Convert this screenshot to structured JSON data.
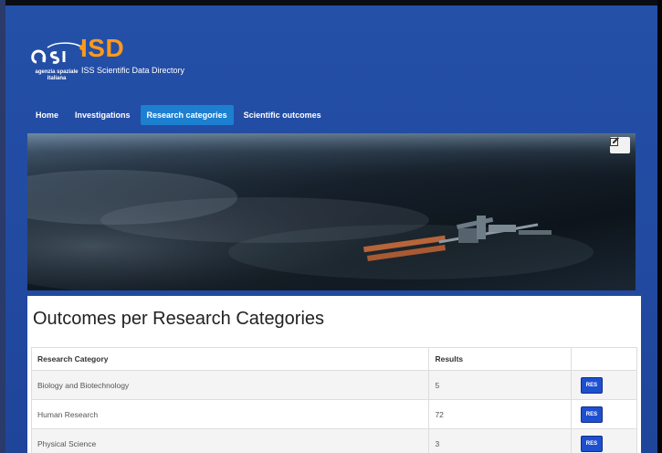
{
  "header": {
    "logo_caption": "agenzia spaziale italiana",
    "title": "ISD",
    "subtitle": "ISS Scientific Data Directory",
    "title_color": "#ff9a1a"
  },
  "nav": {
    "items": [
      {
        "label": "Home"
      },
      {
        "label": "Investigations"
      },
      {
        "label": "Research categories",
        "active": true
      },
      {
        "label": "Scientific outcomes"
      }
    ],
    "active_color": "#1d7fd0"
  },
  "hero": {
    "image": "earth-and-iss-photo",
    "edit_icon": "edit-icon"
  },
  "content": {
    "title": "Outcomes per Research Categories",
    "table": {
      "headers": [
        "Research Category",
        "Results",
        ""
      ],
      "rows": [
        {
          "category": "Biology and Biotechnology",
          "results": "5",
          "action": "RES"
        },
        {
          "category": "Human Research",
          "results": "72",
          "action": "RES"
        },
        {
          "category": "Physical Science",
          "results": "3",
          "action": "RES"
        }
      ]
    }
  },
  "colors": {
    "background": "#224aa0",
    "button": "#1e4fcf"
  }
}
